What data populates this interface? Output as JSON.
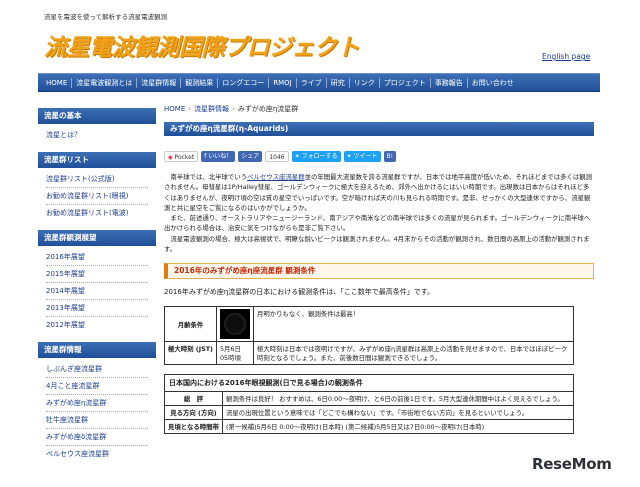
{
  "header": {
    "tagline": "流星を電波を使って解析する流星電波観測",
    "logo": "流星電波観測国際プロジェクト",
    "english_link": "English page"
  },
  "nav": [
    "HOME",
    "流星電波観測とは",
    "流星群情報",
    "観測結果",
    "ロングエコー",
    "RMOJ",
    "ライブ",
    "研究",
    "リンク",
    "プロジェクト",
    "事務報告",
    "お問い合わせ"
  ],
  "sidebar": [
    {
      "heading": "流星の基本",
      "links": [
        "流星とは？"
      ]
    },
    {
      "heading": "流星群リスト",
      "links": [
        "流星群リスト(公式版)",
        "お勧め流星群リスト(眼視)",
        "お勧め流星群リスト(電波)"
      ]
    },
    {
      "heading": "流星群観測展望",
      "links": [
        "2016年展望",
        "2015年展望",
        "2014年展望",
        "2013年展望",
        "2012年展望"
      ]
    },
    {
      "heading": "流星群情報",
      "links": [
        "しぶんぎ座流星群",
        "4月こと座流星群",
        "みずがめ座η流星群",
        "牡牛座流星群",
        "みずがめ座δ流星群",
        "ペルセウス座流星群"
      ]
    }
  ],
  "breadcrumb": [
    "HOME",
    "流星群情報",
    "みずがめ座η流星群"
  ],
  "page_title": "みずがめ座η流星群(η-Aquarids)",
  "social": {
    "pocket": "Pocket",
    "facebook": "いいね！",
    "share": "シェア",
    "count": "1046",
    "follow": "フォローする",
    "tweet": "ツイート",
    "bookmark": "B!"
  },
  "body": {
    "p1a": "南半球では、北半球でいう",
    "p1_link": "ペルセウス座流星群",
    "p1b": "並の年間最大流星数を誇る流星群ですが、日本では地平高度が低いため、それほどまでは多くは観測されません。母彗星は1P/Halley彗星、ゴールデンウィークに極大を迎えるため、郊外へ出かけるにはいい時期です。出現数は日本からはそれほど多くはありませんが、夜明け頃の空は質の星空でいっぱいです。空が暗ければ天の川も見られる時期です。是非、せっかくの大型連休ですから、流星観測と共に星空をご覧になるのはいかがでしょうか。",
    "p2": "また、前述通り、オーストラリアやニュージーランド、南アジアや南米などの南半球では多くの流星が見られます。ゴールデンウィークに南半球へ出かけられる場合は、治安に気をつけながらも是非ご覧下さい。",
    "p3": "流星電波観測の場合、極大は高視状で、明瞭な鋭いピークは観測されません。4月末からその活動が観測され、数日間の高原上の活動が観測されます。"
  },
  "section_title": "2016年のみずがめ座η座流星群 観測条件",
  "section_lead": "2016年みずがめ座η流星群の日本における観測条件は、「ここ数年で最高条件」です。",
  "table1": {
    "moon_label": "月齢条件",
    "moon_note": "月明かりもなく、観測条件は最高！",
    "peak_label": "極大時刻 (JST)",
    "peak_date": "5月6日 05時頃",
    "peak_note": "極大時刻は日本では夜明けですが、みずがめ座η流星群は高原上の活動を見せますので、日本ではほぼピーク時刻となるでしょう。また、前後数日間は観測できるでしょう。"
  },
  "table2": {
    "caption": "日本国内における2016年眼視観測(日で見る場合)の観測条件",
    "rows": [
      {
        "label": "総　評",
        "value": "観測条件は良好！ おすすめは、6日0:00〜夜明け、と6日の前後1日です。5月大型連休期間中はよく見えるでしょう。"
      },
      {
        "label": "見る方向 (方向)",
        "value": "流星の出現位置という意味では「どこでも構わない」です。「市街地でない方向」を見るといいでしょう。"
      },
      {
        "label": "見頃となる時間帯",
        "value": "(第一候補)5月6日 0:00〜夜明け(日本時) (第二候補)5月5日又は7日0:00〜夜明け(日本時)"
      }
    ]
  },
  "watermark": "ReseMom"
}
